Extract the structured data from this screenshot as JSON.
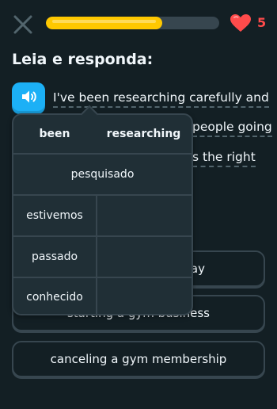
{
  "progress": {
    "fraction": 0.67
  },
  "hearts": {
    "count": "5",
    "color": "#ff4b4b"
  },
  "instruction": "Leia e responda:",
  "passage": {
    "line1": "I've been researching carefully and",
    "line2": "people going",
    "line3": "s the right"
  },
  "options": {
    "opt1_visible": "ay",
    "opt2": "starting a gym business",
    "opt3": "canceling a gym membership"
  },
  "popover": {
    "header_word1": "been",
    "header_word2": "researching",
    "combined_translation": "pesquisado",
    "translations": [
      "estivemos",
      "passado",
      "conhecido"
    ]
  },
  "colors": {
    "background": "#131f24",
    "accent_blue": "#1cb0f6",
    "progress_yellow": "#ffc800",
    "border": "#37464f"
  },
  "icons": {
    "close": "close-icon",
    "heart": "heart-icon",
    "speaker": "speaker-icon"
  }
}
